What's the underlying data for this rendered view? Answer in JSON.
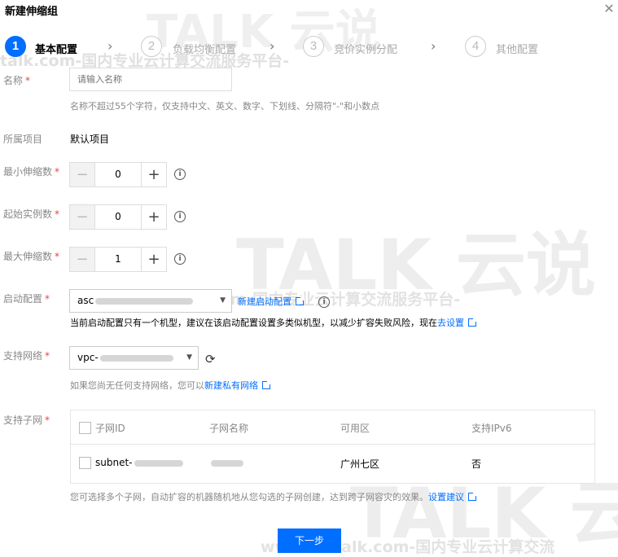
{
  "dialog": {
    "title": "新建伸缩组"
  },
  "watermark": {
    "brand": "TALK 云说",
    "url": "talk.com-国内专业云计算交流服务平台-",
    "url2": "www.idctalk.com-国内专业云计算交流服务平台-",
    "url3": "www.idctalk.com-国内专业云计算交流"
  },
  "steps": [
    {
      "num": "1",
      "label": "基本配置",
      "active": true
    },
    {
      "num": "2",
      "label": "负载均衡配置",
      "active": false
    },
    {
      "num": "3",
      "label": "竞价实例分配",
      "active": false
    },
    {
      "num": "4",
      "label": "其他配置",
      "active": false
    }
  ],
  "form": {
    "name": {
      "label": "名称",
      "placeholder": "请输入名称",
      "help": "名称不超过55个字符，仅支持中文、英文、数字、下划线、分隔符\"-\"和小数点"
    },
    "project": {
      "label": "所属项目",
      "value": "默认项目"
    },
    "min_size": {
      "label": "最小伸缩数",
      "value": "0"
    },
    "initial_size": {
      "label": "起始实例数",
      "value": "0"
    },
    "max_size": {
      "label": "最大伸缩数",
      "value": "1"
    },
    "launch_config": {
      "label": "启动配置",
      "value": "asc",
      "create_link": "新建启动配置",
      "warning": "当前启动配置只有一个机型，建议在该启动配置设置多类似机型，以减少扩容失败风险，现在",
      "warning_link": "去设置"
    },
    "vpc": {
      "label": "支持网络",
      "value": "vpc-",
      "help": "如果您尚无任何支持网络，您可以",
      "help_link": "新建私有网络"
    },
    "subnet": {
      "label": "支持子网",
      "columns": [
        "子网ID",
        "子网名称",
        "可用区",
        "支持IPv6"
      ],
      "rows": [
        {
          "id": "subnet-",
          "name": "",
          "zone": "广州七区",
          "ipv6": "否"
        }
      ],
      "help": "您可选择多个子网，自动扩容的机器随机地从您勾选的子网创建，达到跨子网容灾的效果。",
      "help_link": "设置建议"
    }
  },
  "footer": {
    "next_label": "下一步"
  },
  "colors": {
    "primary": "#006eff",
    "required": "#e54545"
  },
  "icons": {
    "close": "close-icon",
    "step_arrow": "chevron-right-icon",
    "info": "info-circle-icon",
    "refresh": "refresh-icon",
    "external": "external-link-icon",
    "caret": "caret-down-icon"
  }
}
